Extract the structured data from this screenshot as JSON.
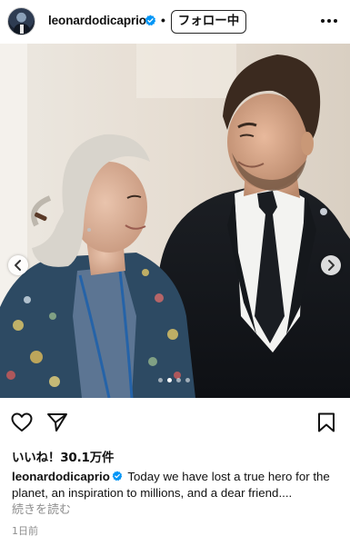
{
  "post": {
    "username": "leonardodicaprio",
    "dot": "•",
    "follow_label": "フォロー中",
    "more_icon": "more-horizontal-icon",
    "verified_icon": "verified-badge-icon"
  },
  "carousel": {
    "slide_count": 4,
    "active_index": 1,
    "prev_icon": "chevron-left-icon",
    "next_icon": "chevron-right-icon"
  },
  "actions": {
    "like_icon": "heart-icon",
    "share_icon": "paper-plane-icon",
    "save_icon": "bookmark-icon"
  },
  "likes": {
    "text": "いいね！30.1万件"
  },
  "caption": {
    "username": "leonardodicaprio",
    "text": "Today we have lost a true hero for the planet, an inspiration to millions, and a dear friend....",
    "more_label": "続きを読む"
  },
  "timestamp": "1日前",
  "colors": {
    "verified": "#0095f6",
    "muted_text": "#8e8e8e",
    "text": "#111111"
  }
}
